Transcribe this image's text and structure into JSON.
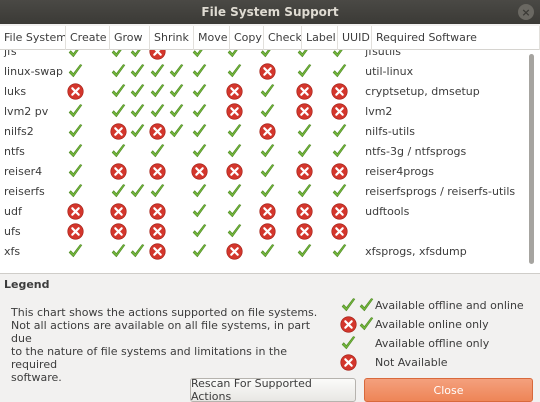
{
  "window": {
    "title": "File System Support"
  },
  "columns": [
    "File System",
    "Create",
    "Grow",
    "Shrink",
    "Move",
    "Copy",
    "Check",
    "Label",
    "UUID",
    "Required Software"
  ],
  "rows": [
    {
      "name": "jfs",
      "create": [
        "ok"
      ],
      "grow": [
        "ok",
        "ok"
      ],
      "shrink": [
        "no"
      ],
      "move": [
        "ok"
      ],
      "copy": [
        "ok"
      ],
      "check": [
        "ok"
      ],
      "label": [
        "ok"
      ],
      "uuid": [
        "ok"
      ],
      "software": "jfsutils"
    },
    {
      "name": "linux-swap",
      "create": [
        "ok"
      ],
      "grow": [
        "ok",
        "ok"
      ],
      "shrink": [
        "ok",
        "ok"
      ],
      "move": [
        "ok"
      ],
      "copy": [
        "ok"
      ],
      "check": [
        "no"
      ],
      "label": [
        "ok"
      ],
      "uuid": [
        "ok"
      ],
      "software": "util-linux"
    },
    {
      "name": "luks",
      "create": [
        "no"
      ],
      "grow": [
        "ok",
        "ok"
      ],
      "shrink": [
        "ok",
        "ok"
      ],
      "move": [
        "ok"
      ],
      "copy": [
        "no"
      ],
      "check": [
        "ok"
      ],
      "label": [
        "no"
      ],
      "uuid": [
        "no"
      ],
      "software": "cryptsetup, dmsetup"
    },
    {
      "name": "lvm2 pv",
      "create": [
        "ok"
      ],
      "grow": [
        "ok",
        "ok"
      ],
      "shrink": [
        "ok",
        "ok"
      ],
      "move": [
        "ok"
      ],
      "copy": [
        "no"
      ],
      "check": [
        "ok"
      ],
      "label": [
        "no"
      ],
      "uuid": [
        "no"
      ],
      "software": "lvm2"
    },
    {
      "name": "nilfs2",
      "create": [
        "ok"
      ],
      "grow": [
        "no",
        "ok"
      ],
      "shrink": [
        "no",
        "ok"
      ],
      "move": [
        "ok"
      ],
      "copy": [
        "ok"
      ],
      "check": [
        "no"
      ],
      "label": [
        "ok"
      ],
      "uuid": [
        "ok"
      ],
      "software": "nilfs-utils"
    },
    {
      "name": "ntfs",
      "create": [
        "ok"
      ],
      "grow": [
        "ok"
      ],
      "shrink": [
        "ok"
      ],
      "move": [
        "ok"
      ],
      "copy": [
        "ok"
      ],
      "check": [
        "ok"
      ],
      "label": [
        "ok"
      ],
      "uuid": [
        "ok"
      ],
      "software": "ntfs-3g / ntfsprogs"
    },
    {
      "name": "reiser4",
      "create": [
        "ok"
      ],
      "grow": [
        "no"
      ],
      "shrink": [
        "no"
      ],
      "move": [
        "no"
      ],
      "copy": [
        "no"
      ],
      "check": [
        "ok"
      ],
      "label": [
        "no"
      ],
      "uuid": [
        "no"
      ],
      "software": "reiser4progs"
    },
    {
      "name": "reiserfs",
      "create": [
        "ok"
      ],
      "grow": [
        "ok",
        "ok"
      ],
      "shrink": [
        "ok"
      ],
      "move": [
        "ok"
      ],
      "copy": [
        "ok"
      ],
      "check": [
        "ok"
      ],
      "label": [
        "ok"
      ],
      "uuid": [
        "ok"
      ],
      "software": "reiserfsprogs / reiserfs-utils"
    },
    {
      "name": "udf",
      "create": [
        "no"
      ],
      "grow": [
        "no"
      ],
      "shrink": [
        "no"
      ],
      "move": [
        "ok"
      ],
      "copy": [
        "ok"
      ],
      "check": [
        "no"
      ],
      "label": [
        "no"
      ],
      "uuid": [
        "no"
      ],
      "software": "udftools"
    },
    {
      "name": "ufs",
      "create": [
        "no"
      ],
      "grow": [
        "no"
      ],
      "shrink": [
        "no"
      ],
      "move": [
        "ok"
      ],
      "copy": [
        "ok"
      ],
      "check": [
        "no"
      ],
      "label": [
        "no"
      ],
      "uuid": [
        "no"
      ],
      "software": ""
    },
    {
      "name": "xfs",
      "create": [
        "ok"
      ],
      "grow": [
        "ok",
        "ok"
      ],
      "shrink": [
        "no"
      ],
      "move": [
        "ok"
      ],
      "copy": [
        "no"
      ],
      "check": [
        "ok"
      ],
      "label": [
        "ok"
      ],
      "uuid": [
        "ok"
      ],
      "software": "xfsprogs, xfsdump"
    }
  ],
  "legend": {
    "title": "Legend",
    "description": "This chart shows the actions supported on file systems.\nNot all actions are available on all file systems, in part due\nto the nature of file systems and limitations in the required\nsoftware.",
    "keys": [
      {
        "icons": [
          "ok",
          "ok"
        ],
        "label": "Available offline and online"
      },
      {
        "icons": [
          "no",
          "ok"
        ],
        "label": "Available online only"
      },
      {
        "icons": [
          "ok"
        ],
        "label": "Available offline only"
      },
      {
        "icons": [
          "no"
        ],
        "label": "Not Available"
      }
    ]
  },
  "buttons": {
    "rescan": "Rescan For Supported Actions",
    "close": "Close"
  },
  "colors": {
    "check": "#73b63c",
    "cross": "#d3362c",
    "close_button": "#ef8a5c",
    "titlebar": "#3c3b37"
  }
}
